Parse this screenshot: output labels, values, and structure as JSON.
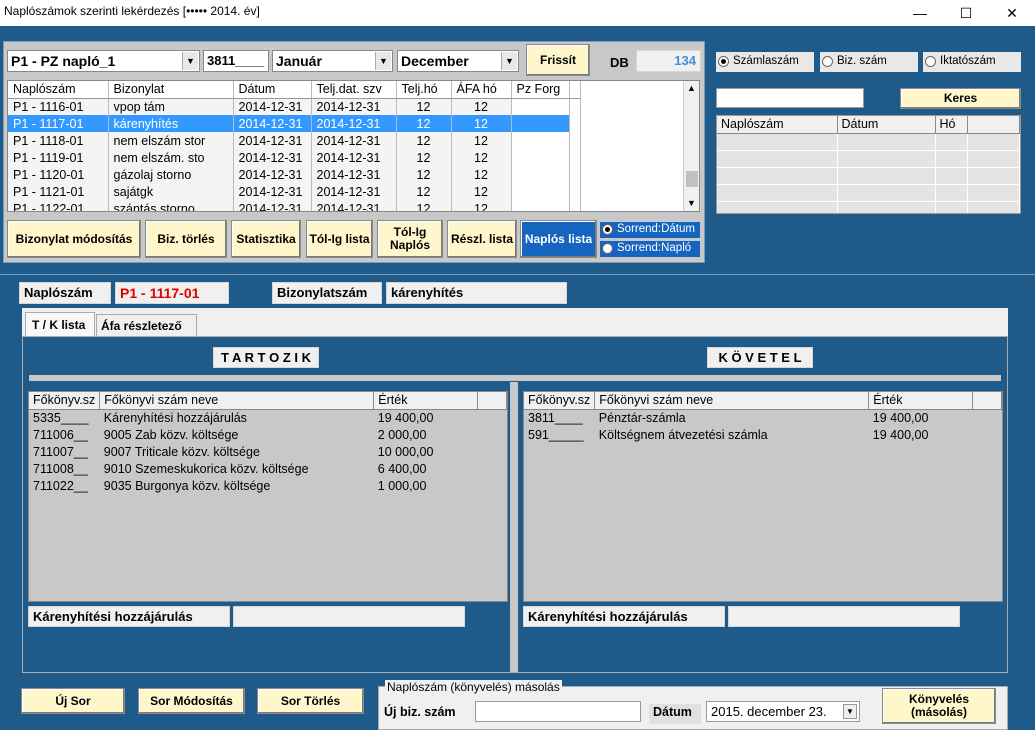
{
  "window": {
    "title": "Naplószámok szerinti lekérdezés  [••••• 2014. év]",
    "minimize": "—",
    "maximize": "☐",
    "close": "✕"
  },
  "top": {
    "naplo_combo": "P1 - PZ napló_1",
    "account": "3811____",
    "month_from": "Január",
    "month_to": "December",
    "refresh": "Frissít",
    "db_label": "DB",
    "db_value": "134"
  },
  "journal_table": {
    "headers": [
      "Naplószám",
      "Bizonylat",
      "Dátum",
      "Telj.dat. szv",
      "Telj.hó",
      "ÁFA hó",
      "Pz Forg"
    ],
    "rows": [
      [
        "P1 - 1116-01",
        "vpop tám",
        "2014-12-31",
        "2014-12-31",
        "12",
        "12",
        ""
      ],
      [
        "P1 - 1117-01",
        "kárenyhítés",
        "2014-12-31",
        "2014-12-31",
        "12",
        "12",
        ""
      ],
      [
        "P1 - 1118-01",
        "nem elszám stor",
        "2014-12-31",
        "2014-12-31",
        "12",
        "12",
        ""
      ],
      [
        "P1 - 1119-01",
        "nem elszám. sto",
        "2014-12-31",
        "2014-12-31",
        "12",
        "12",
        ""
      ],
      [
        "P1 - 1120-01",
        "gázolaj storno",
        "2014-12-31",
        "2014-12-31",
        "12",
        "12",
        ""
      ],
      [
        "P1 - 1121-01",
        "sajátgk",
        "2014-12-31",
        "2014-12-31",
        "12",
        "12",
        ""
      ],
      [
        "P1 - 1122-01",
        "szántás storno",
        "2014-12-31",
        "2014-12-31",
        "12",
        "12",
        ""
      ]
    ],
    "selected": 1
  },
  "actions": {
    "modify": "Bizonylat módosítás",
    "delete": "Biz. törlés",
    "stats": "Statisztika",
    "range_list": "Tól-Ig lista",
    "range_journal": "Tól-Ig Naplós",
    "detail_list": "Részl. lista",
    "journal_list": "Naplós lista",
    "sort_date": "Sorrend:Dátum",
    "sort_journal": "Sorrend:Napló"
  },
  "search": {
    "opt1": "Számlaszám",
    "opt2": "Biz. szám",
    "opt3": "Iktatószám",
    "button": "Keres",
    "value": "",
    "headers": [
      "Naplószám",
      "Dátum",
      "Hó"
    ]
  },
  "detail": {
    "naplo_label": "Naplószám",
    "naplo_value": "P1 - 1117-01",
    "biz_label": "Bizonylatszám",
    "biz_value": "kárenyhítés",
    "tab1": "T / K lista",
    "tab2": "Áfa részletező"
  },
  "debit": {
    "title": "T A R T O Z I K",
    "headers": [
      "Főkönyv.sz",
      "Főkönyvi szám neve",
      "Érték"
    ],
    "rows": [
      [
        "5335____",
        "Kárenyhítési hozzájárulás",
        "19 400,00"
      ],
      [
        "711006__",
        "9005 Zab közv. költsége",
        "2 000,00"
      ],
      [
        "711007__",
        "9007 Triticale közv. költsége",
        "10 000,00"
      ],
      [
        "711008__",
        "9010 Szemeskukorica közv. költsége",
        "6 400,00"
      ],
      [
        "711022__",
        "9035 Burgonya közv. költsége",
        "1 000,00"
      ]
    ],
    "footer": "Kárenyhítési hozzájárulás"
  },
  "credit": {
    "title": "K Ö V E T E L",
    "headers": [
      "Főkönyv.sz",
      "Főkönyvi szám neve",
      "Érték"
    ],
    "rows": [
      [
        "3811____",
        "Pénztár-számla",
        "19 400,00"
      ],
      [
        "591_____",
        "Költségnem átvezetési számla",
        "19 400,00"
      ]
    ],
    "footer": "Kárenyhítési hozzájárulás"
  },
  "bottom": {
    "new_row": "Új Sor",
    "modify_row": "Sor Módosítás",
    "delete_row": "Sor Törlés",
    "copy_group": "Naplószám (könyvelés) másolás",
    "new_biz_label": "Új biz. szám",
    "new_biz_value": "",
    "date_label": "Dátum",
    "date_value": "2015. december 23.",
    "book": "Könyvelés (másolás)"
  }
}
